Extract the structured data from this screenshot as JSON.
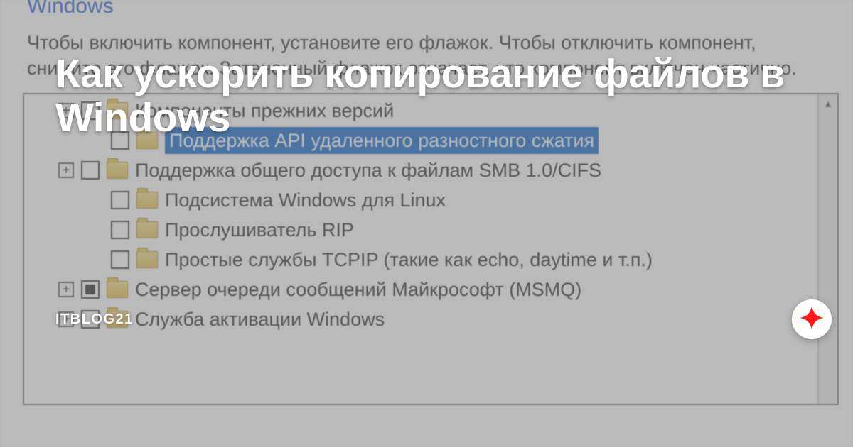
{
  "window": {
    "title_partial": "Windows",
    "description": "Чтобы включить компонент, установите его флажок. Чтобы отключить компонент, снимите его флажок. Затененный флажок означает, что компонент включен частично."
  },
  "tree": {
    "items": [
      {
        "label": "Компоненты прежних версий",
        "expand": "+",
        "check": "unchecked",
        "indent": 1,
        "selected": false
      },
      {
        "label": "Поддержка API удаленного разностного сжатия",
        "expand": null,
        "check": "unchecked",
        "indent": 2,
        "selected": true
      },
      {
        "label": "Поддержка общего доступа к файлам SMB 1.0/CIFS",
        "expand": "+",
        "check": "unchecked",
        "indent": 1,
        "selected": false
      },
      {
        "label": "Подсистема Windows для Linux",
        "expand": null,
        "check": "unchecked",
        "indent": 2,
        "selected": false
      },
      {
        "label": "Прослушиватель RIP",
        "expand": null,
        "check": "unchecked",
        "indent": 2,
        "selected": false
      },
      {
        "label": "Простые службы TCPIP (такие как echo, daytime и т.п.)",
        "expand": null,
        "check": "unchecked",
        "indent": 2,
        "selected": false
      },
      {
        "label": "Сервер очереди сообщений Майкрософт (MSMQ)",
        "expand": "+",
        "check": "partial",
        "indent": 1,
        "selected": false
      },
      {
        "label": "Служба активации Windows",
        "expand": "+",
        "check": "unchecked",
        "indent": 1,
        "selected": false
      }
    ]
  },
  "overlay": {
    "headline": "Как ускорить копирование файлов в Windows",
    "source": "ITBLOG21"
  }
}
